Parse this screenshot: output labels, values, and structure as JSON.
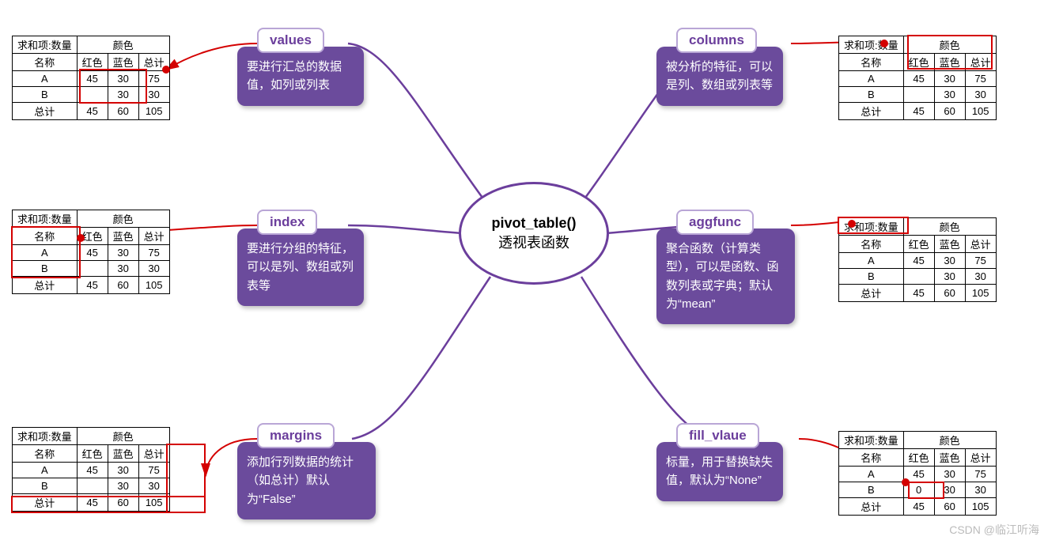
{
  "center": {
    "title": "pivot_table()",
    "subtitle": "透视表函数"
  },
  "params": {
    "values": {
      "label": "values",
      "desc": "要进行汇总的数据值，如列或列表"
    },
    "index": {
      "label": "index",
      "desc": "要进行分组的特征，可以是列、数组或列表等"
    },
    "margins": {
      "label": "margins",
      "desc": "添加行列数据的统计（如总计）默认为“False”"
    },
    "columns": {
      "label": "columns",
      "desc": "被分析的特征，可以是列、数组或列表等"
    },
    "aggfunc": {
      "label": "aggfunc",
      "desc": "聚合函数（计算类型），可以是函数、函数列表或字典；默认为“mean”"
    },
    "fill_value": {
      "label": "fill_vlaue",
      "desc": "标量，用于替换缺失值，默认为“None”"
    }
  },
  "table_base": {
    "corner": "求和项:数量",
    "group_label": "颜色",
    "name_label": "名称",
    "col1": "红色",
    "col2": "蓝色",
    "total": "总计",
    "rows": [
      {
        "name": "A",
        "c1": "45",
        "c2": "30",
        "t": "75"
      },
      {
        "name": "B",
        "c1": "",
        "c2": "30",
        "t": "30"
      },
      {
        "name": "总计",
        "c1": "45",
        "c2": "60",
        "t": "105"
      }
    ]
  },
  "fill_value_cell": "0",
  "watermark": "CSDN @临江听海"
}
